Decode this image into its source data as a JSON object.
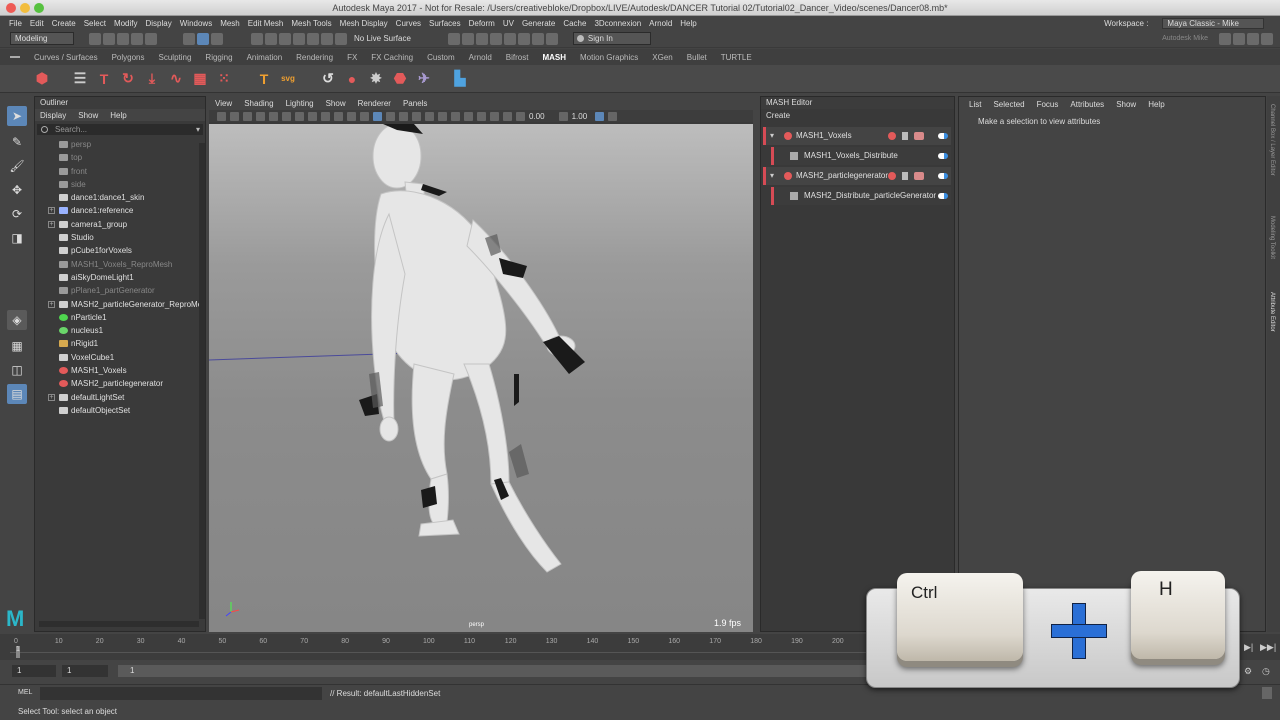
{
  "window": {
    "title": "Autodesk Maya 2017 - Not for Resale: /Users/creativebloke/Dropbox/LIVE/Autodesk/DANCER Tutorial 02/Tutorial02_Dancer_Video/scenes/Dancer08.mb*"
  },
  "menubar": {
    "items": [
      "File",
      "Edit",
      "Create",
      "Select",
      "Modify",
      "Display",
      "Windows",
      "Mesh",
      "Edit Mesh",
      "Mesh Tools",
      "Mesh Display",
      "Curves",
      "Surfaces",
      "Deform",
      "UV",
      "Generate",
      "Cache",
      "3Dconnexion",
      "Arnold",
      "Help"
    ],
    "workspace_label": "Workspace :",
    "workspace_value": "Maya Classic - Mike"
  },
  "statusline": {
    "mode": "Modeling",
    "live_surface": "No Live Surface",
    "signin": "Sign In",
    "brand": "Autodesk Mike"
  },
  "shelf": {
    "tabs": [
      "Curves / Surfaces",
      "Polygons",
      "Sculpting",
      "Rigging",
      "Animation",
      "Rendering",
      "FX",
      "FX Caching",
      "Custom",
      "Arnold",
      "Bifrost",
      "MASH",
      "Motion Graphics",
      "XGen",
      "Bullet",
      "TURTLE"
    ],
    "active_tab": "MASH"
  },
  "outliner": {
    "title": "Outliner",
    "menu": [
      "Display",
      "Show",
      "Help"
    ],
    "search_placeholder": "Search...",
    "items": [
      {
        "label": "persp",
        "dim": true,
        "icon": "camera-icon",
        "color": "#9a9a9a"
      },
      {
        "label": "top",
        "dim": true,
        "icon": "camera-icon",
        "color": "#9a9a9a"
      },
      {
        "label": "front",
        "dim": true,
        "icon": "camera-icon",
        "color": "#9a9a9a"
      },
      {
        "label": "side",
        "dim": true,
        "icon": "camera-icon",
        "color": "#9a9a9a"
      },
      {
        "label": "dance1:dance1_skin",
        "dim": false,
        "icon": "mesh-icon",
        "color": "#cfcfcf"
      },
      {
        "label": "dance1:reference",
        "dim": false,
        "icon": "joint-icon",
        "color": "#9ab3ff",
        "expand": true
      },
      {
        "label": "camera1_group",
        "dim": false,
        "icon": "camera-icon",
        "color": "#cfcfcf",
        "expand": true
      },
      {
        "label": "Studio",
        "dim": false,
        "icon": "mesh-icon",
        "color": "#cfcfcf"
      },
      {
        "label": "pCube1forVoxels",
        "dim": false,
        "icon": "mesh-icon",
        "color": "#cfcfcf"
      },
      {
        "label": "MASH1_Voxels_ReproMesh",
        "dim": true,
        "icon": "mesh-icon",
        "color": "#9a9a9a"
      },
      {
        "label": "aiSkyDomeLight1",
        "dim": false,
        "icon": "mesh-icon",
        "color": "#cfcfcf"
      },
      {
        "label": "pPlane1_partGenerator",
        "dim": true,
        "icon": "mesh-icon",
        "color": "#9a9a9a"
      },
      {
        "label": "MASH2_particleGenerator_ReproMe",
        "dim": false,
        "icon": "mesh-icon",
        "color": "#cfcfcf",
        "expand": true
      },
      {
        "label": "nParticle1",
        "dim": false,
        "icon": "particle-icon",
        "color": "#4fd64f"
      },
      {
        "label": "nucleus1",
        "dim": false,
        "icon": "nucleus-icon",
        "color": "#6ad66a"
      },
      {
        "label": "nRigid1",
        "dim": false,
        "icon": "rigid-icon",
        "color": "#d6a94f"
      },
      {
        "label": "VoxelCube1",
        "dim": false,
        "icon": "voxel-icon",
        "color": "#cfcfcf"
      },
      {
        "label": "MASH1_Voxels",
        "dim": false,
        "icon": "mash-icon",
        "color": "#e35a5a"
      },
      {
        "label": "MASH2_particlegenerator",
        "dim": false,
        "icon": "mash-icon",
        "color": "#e35a5a"
      },
      {
        "label": "defaultLightSet",
        "dim": false,
        "icon": "set-icon",
        "color": "#cfcfcf",
        "expand": true
      },
      {
        "label": "defaultObjectSet",
        "dim": false,
        "icon": "set-icon",
        "color": "#cfcfcf"
      }
    ]
  },
  "viewport": {
    "menu": [
      "View",
      "Shading",
      "Lighting",
      "Show",
      "Renderer",
      "Panels"
    ],
    "value_a": "0.00",
    "value_b": "1.00",
    "camera": "persp",
    "fps": "1.9 fps"
  },
  "mash_editor": {
    "title": "MASH Editor",
    "create": "Create",
    "nodes": [
      {
        "label": "MASH1_Voxels",
        "children": [
          "MASH1_Voxels_Distribute"
        ]
      },
      {
        "label": "MASH2_particlegenerator",
        "children": [
          "MASH2_Distribute_particleGenerator"
        ]
      }
    ]
  },
  "attribute_editor": {
    "menu": [
      "List",
      "Selected",
      "Focus",
      "Attributes",
      "Show",
      "Help"
    ],
    "message": "Make a selection to view attributes",
    "side_tabs": [
      "Channel Box / Layer Editor",
      "Modeling Toolkit",
      "Attribute Editor"
    ]
  },
  "timeline": {
    "ticks": [
      "0",
      "10",
      "20",
      "30",
      "40",
      "50",
      "60",
      "70",
      "80",
      "90",
      "100",
      "110",
      "120",
      "130",
      "140",
      "150",
      "160",
      "170",
      "180",
      "190",
      "200"
    ],
    "current": "1"
  },
  "range": {
    "start": "1",
    "playback_start": "1",
    "slider_value": "1"
  },
  "command": {
    "lang": "MEL",
    "result": "// Result: defaultLastHiddenSet"
  },
  "help_line": "Select Tool: select an object",
  "shortcut_overlay": {
    "key1": "Ctrl",
    "key2": "H"
  }
}
